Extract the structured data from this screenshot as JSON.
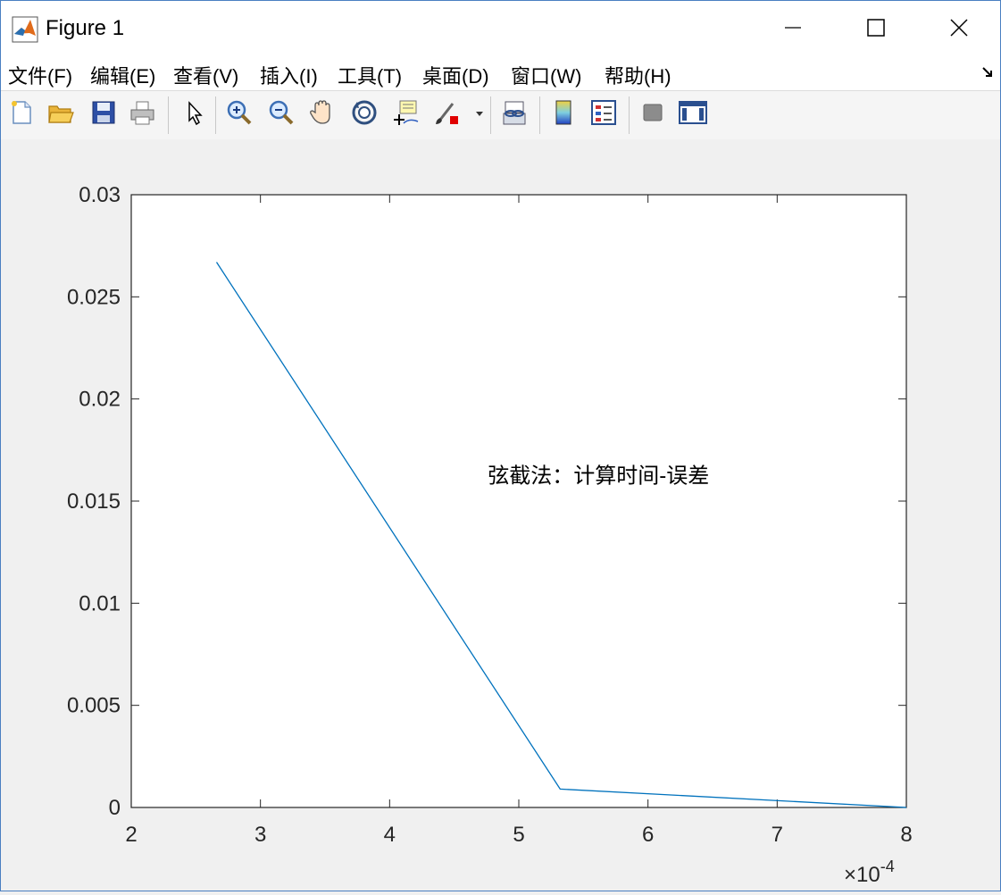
{
  "window": {
    "title": "Figure 1",
    "controls": {
      "minimize": "minimize-icon",
      "maximize": "maximize-icon",
      "close": "close-icon"
    }
  },
  "menu": {
    "items": [
      {
        "label": "文件(F)"
      },
      {
        "label": "编辑(E)"
      },
      {
        "label": "查看(V)"
      },
      {
        "label": "插入(I)"
      },
      {
        "label": "工具(T)"
      },
      {
        "label": "桌面(D)"
      },
      {
        "label": "窗口(W)"
      },
      {
        "label": "帮助(H)"
      }
    ]
  },
  "toolbar": {
    "tools": [
      "new-file-icon",
      "open-folder-icon",
      "save-icon",
      "print-icon",
      "pointer-icon",
      "zoom-in-icon",
      "zoom-out-icon",
      "pan-hand-icon",
      "rotate-3d-icon",
      "data-cursor-icon",
      "brush-icon",
      "link-plot-icon",
      "colorbar-icon",
      "legend-icon",
      "hide-plot-tools-icon",
      "show-plot-tools-icon"
    ]
  },
  "chart_data": {
    "type": "line",
    "x": [
      2.66,
      5.32,
      8.0
    ],
    "x_multiplier": "×10^-4",
    "series": [
      {
        "values": [
          0.0267,
          0.0009,
          0.0
        ]
      }
    ],
    "xlim": [
      2,
      8
    ],
    "ylim": [
      0,
      0.03
    ],
    "xticks": [
      "2",
      "3",
      "4",
      "5",
      "6",
      "7",
      "8"
    ],
    "yticks": [
      "0",
      "0.005",
      "0.01",
      "0.015",
      "0.02",
      "0.025",
      "0.03"
    ],
    "annotation": "弦截法：计算时间-误差",
    "grid": false,
    "line_color": "#0072bd"
  }
}
